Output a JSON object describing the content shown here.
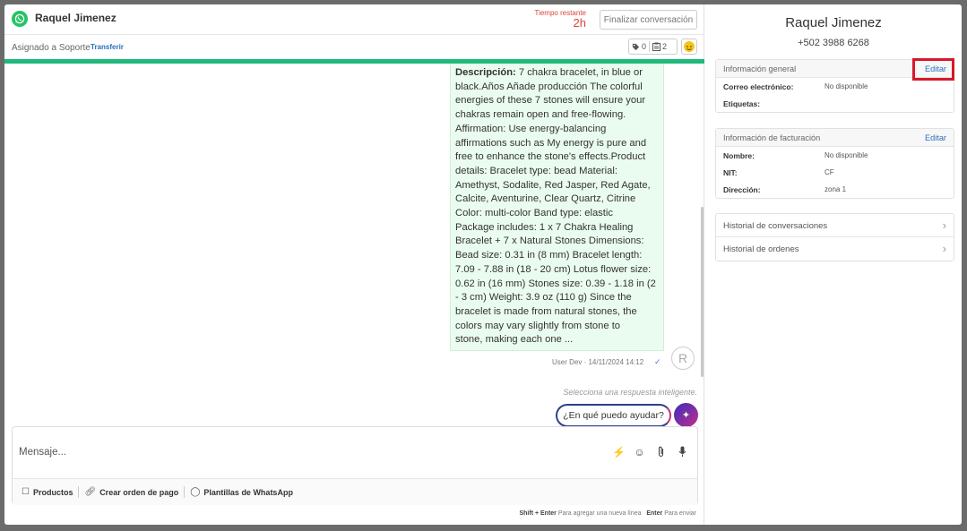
{
  "header": {
    "contact_name": "Raquel Jimenez",
    "time_label": "Tiempo restante",
    "time_value": "2h",
    "finalize_label": "Finalizar conversación"
  },
  "subheader": {
    "assigned": "Asignado a Soporte",
    "transfer": "Transferir",
    "tags_count": "0",
    "orders_count": "2"
  },
  "message": {
    "label": "Descripción:",
    "lines": [
      " 7 chakra bracelet, in blue or",
      "black.Años Añade producción The colorful",
      "energies of these 7 stones will ensure your",
      "chakras remain open and free-flowing.",
      "Affirmation: Use energy-balancing",
      "affirmations such as My energy is pure and",
      "free to enhance the stone's effects.Product",
      "details: Bracelet type: bead Material:",
      "Amethyst, Sodalite, Red Jasper, Red Agate,",
      "Calcite, Aventurine, Clear Quartz, Citrine",
      "Color: multi-color Band type: elastic",
      "Package includes: 1 x 7 Chakra Healing",
      "Bracelet + 7 x Natural Stones Dimensions:",
      "Bead size: 0.31 in (8 mm) Bracelet length:",
      "7.09 - 7.88 in (18 - 20 cm) Lotus flower size:",
      "0.62 in (16 mm) Stones size: 0.39 - 1.18 in (2",
      "- 3 cm) Weight: 3.9 oz (110 g) Since the",
      "bracelet is made from natural stones, the",
      "colors may vary slightly from stone to",
      "stone, making each one ..."
    ],
    "meta": "User Dev  ·  14/11/2024 14:12",
    "avatar_initial": "R"
  },
  "smart_reply": {
    "hint": "Selecciona una respuesta inteligente.",
    "suggestion": "¿En qué puedo ayudar?"
  },
  "composer": {
    "placeholder": "Mensaje...",
    "actions": {
      "products": "Productos",
      "payment_order": "Crear orden de pago",
      "templates": "Plantillas de WhatsApp"
    },
    "shortcut_newline_key": "Shift + Enter",
    "shortcut_newline_text": "Para agregar una nueva línea",
    "shortcut_send_key": "Enter",
    "shortcut_send_text": "Para enviar"
  },
  "side": {
    "name": "Raquel Jimenez",
    "phone": "+502 3988 6268",
    "general": {
      "title": "Información general",
      "edit": "Editar",
      "rows": [
        {
          "k": "Correo electrónico:",
          "v": "No disponible"
        },
        {
          "k": "Etiquetas:",
          "v": ""
        }
      ]
    },
    "billing": {
      "title": "Información de facturación",
      "edit": "Editar",
      "rows": [
        {
          "k": "Nombre:",
          "v": "No disponible"
        },
        {
          "k": "NIT:",
          "v": "CF"
        },
        {
          "k": "Dirección:",
          "v": "zona 1"
        }
      ]
    },
    "links": [
      "Historial de conversaciones",
      "Historial de ordenes"
    ]
  },
  "colors": {
    "accent_green": "#20b97b",
    "whatsapp_green": "#25c366",
    "timer_red": "#d9453c",
    "link_blue": "#2a6fbf",
    "highlight_red": "#d7182a",
    "bubble_bg": "#eafcef"
  },
  "icons": {
    "whatsapp": "whatsapp-icon",
    "tag": "tag-icon",
    "orders": "clipboard-icon",
    "emoji": "emoji-icon",
    "lightning": "lightning-icon",
    "attach": "paperclip-icon",
    "mic": "microphone-icon",
    "magic": "sparkle-icon",
    "chevron": "chevron-right-icon"
  }
}
